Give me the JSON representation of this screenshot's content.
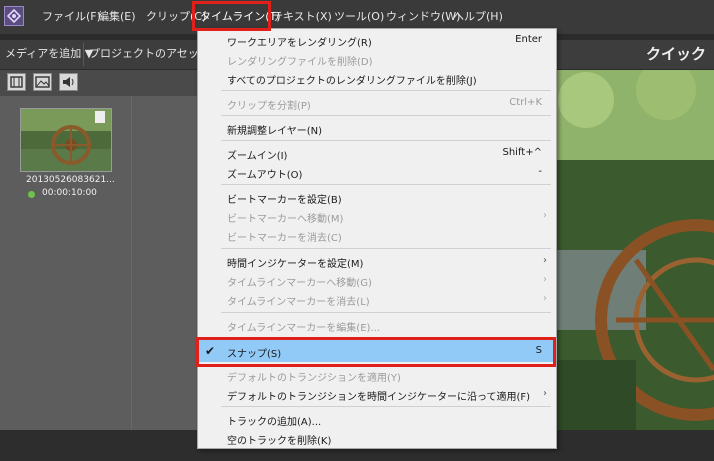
{
  "menubar": {
    "items": [
      {
        "label": "ファイル(F)"
      },
      {
        "label": "編集(E)"
      },
      {
        "label": "クリップ(C)"
      },
      {
        "label": "タイムライン(T)"
      },
      {
        "label": "テキスト(X)"
      },
      {
        "label": "ツール(O)"
      },
      {
        "label": "ウィンドウ(W)"
      },
      {
        "label": "ヘルプ(H)"
      }
    ]
  },
  "toolbar": {
    "add_media": "メディアを追加 ▼",
    "project_assets": "プロジェクトのアセット ▼",
    "quick": "クイック"
  },
  "media": {
    "clip_name": "20130526083621...",
    "clip_duration": "00:00:10:00"
  },
  "timeline_menu": {
    "items": [
      {
        "label": "ワークエリアをレンダリング(R)",
        "shortcut": "Enter",
        "disabled": false
      },
      {
        "label": "レンダリングファイルを削除(D)",
        "shortcut": "",
        "disabled": true
      },
      {
        "label": "すべてのプロジェクトのレンダリングファイルを削除(J)",
        "shortcut": "",
        "disabled": false
      },
      {
        "label": "クリップを分割(P)",
        "shortcut": "Ctrl+K",
        "disabled": true
      },
      {
        "label": "新規調整レイヤー(N)",
        "shortcut": "",
        "disabled": false
      },
      {
        "label": "ズームイン(I)",
        "shortcut": "Shift+^",
        "disabled": false
      },
      {
        "label": "ズームアウト(O)",
        "shortcut": "-",
        "disabled": false
      },
      {
        "label": "ビートマーカーを設定(B)",
        "shortcut": "",
        "disabled": false
      },
      {
        "label": "ビートマーカーへ移動(M)",
        "shortcut": "",
        "disabled": true
      },
      {
        "label": "ビートマーカーを消去(C)",
        "shortcut": "",
        "disabled": true
      },
      {
        "label": "時間インジケーターを設定(M)",
        "shortcut": "",
        "disabled": false
      },
      {
        "label": "タイムラインマーカーへ移動(G)",
        "shortcut": "",
        "disabled": true
      },
      {
        "label": "タイムラインマーカーを消去(L)",
        "shortcut": "",
        "disabled": true
      },
      {
        "label": "タイムラインマーカーを編集(E)...",
        "shortcut": "",
        "disabled": true
      },
      {
        "label": "スナップ(S)",
        "shortcut": "S",
        "disabled": false,
        "checked": true
      },
      {
        "label": "デフォルトのトランジションを適用(Y)",
        "shortcut": "",
        "disabled": true
      },
      {
        "label": "デフォルトのトランジションを時間インジケーターに沿って適用(F)",
        "shortcut": "",
        "disabled": false
      },
      {
        "label": "トラックの追加(A)...",
        "shortcut": "",
        "disabled": false
      },
      {
        "label": "空のトラックを削除(K)",
        "shortcut": "",
        "disabled": false
      }
    ]
  },
  "icons": {
    "app": "premiere-elements-logo-icon",
    "check": "checkmark-icon",
    "submenu": "chevron-right-icon"
  },
  "colors": {
    "highlight": "#91c9f7",
    "annotation_red": "#e0201b",
    "menubar_bg": "#3a3a3a"
  }
}
